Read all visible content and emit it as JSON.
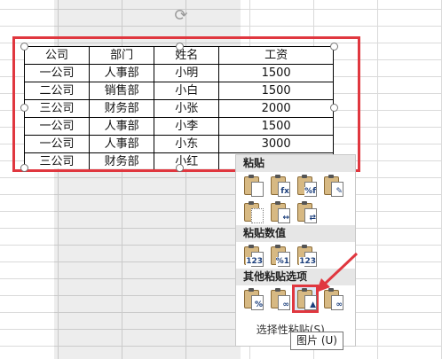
{
  "table": {
    "headers": [
      "公司",
      "部门",
      "姓名",
      "工资"
    ],
    "rows": [
      [
        "一公司",
        "人事部",
        "小明",
        "1500"
      ],
      [
        "二公司",
        "销售部",
        "小白",
        "1500"
      ],
      [
        "三公司",
        "财务部",
        "小张",
        "2000"
      ],
      [
        "一公司",
        "人事部",
        "小李",
        "1500"
      ],
      [
        "一公司",
        "人事部",
        "小东",
        "3000"
      ],
      [
        "三公司",
        "财务部",
        "小红",
        ""
      ]
    ]
  },
  "menu": {
    "paste_title": "粘贴",
    "paste_values_title": "粘贴数值",
    "other_title": "其他粘贴选项",
    "footer_text": "选择性粘贴(S)..."
  },
  "tooltip": "图片 (U)",
  "colors": {
    "highlight": "#e0373f",
    "section_bg": "#e6e6e6"
  }
}
